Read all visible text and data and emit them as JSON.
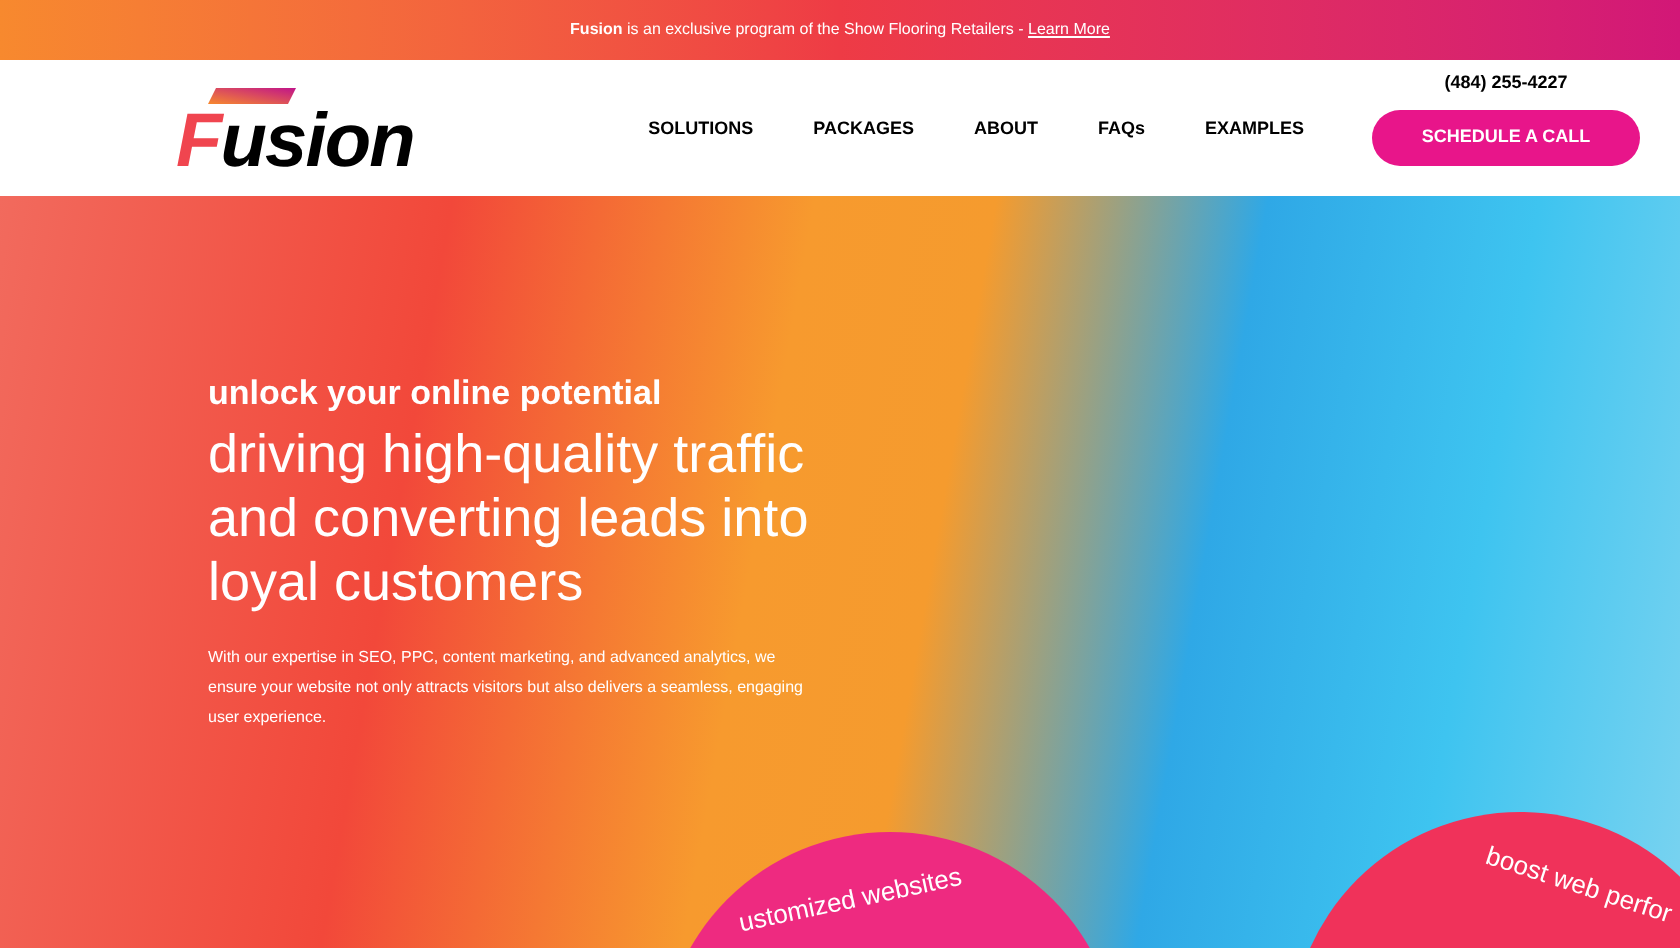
{
  "announcement": {
    "text": "**Fusion** is an exclusive program of the Show Flooring Retailers - ",
    "link": "Learn More"
  },
  "header": {
    "logo": "Fusion",
    "phone": "(484) 255-4227",
    "nav": [
      {
        "label": "SOLUTIONS"
      },
      {
        "label": "PACKAGES"
      },
      {
        "label": "ABOUT"
      },
      {
        "label": "FAQs"
      },
      {
        "label": "EXAMPLES"
      }
    ],
    "cta": "SCHEDULE A CALL"
  },
  "hero": {
    "kicker": "unlock your online potential",
    "headline": "driving high-quality traffic and converting leads into loyal customers",
    "body": "With our expertise in SEO, PPC, content marketing, and advanced analytics, we ensure your website not only attracts visitors but also delivers a seamless, engaging user experience."
  },
  "features": [
    {
      "label": "ustomized websites"
    },
    {
      "label": "boost web perfor"
    }
  ]
}
